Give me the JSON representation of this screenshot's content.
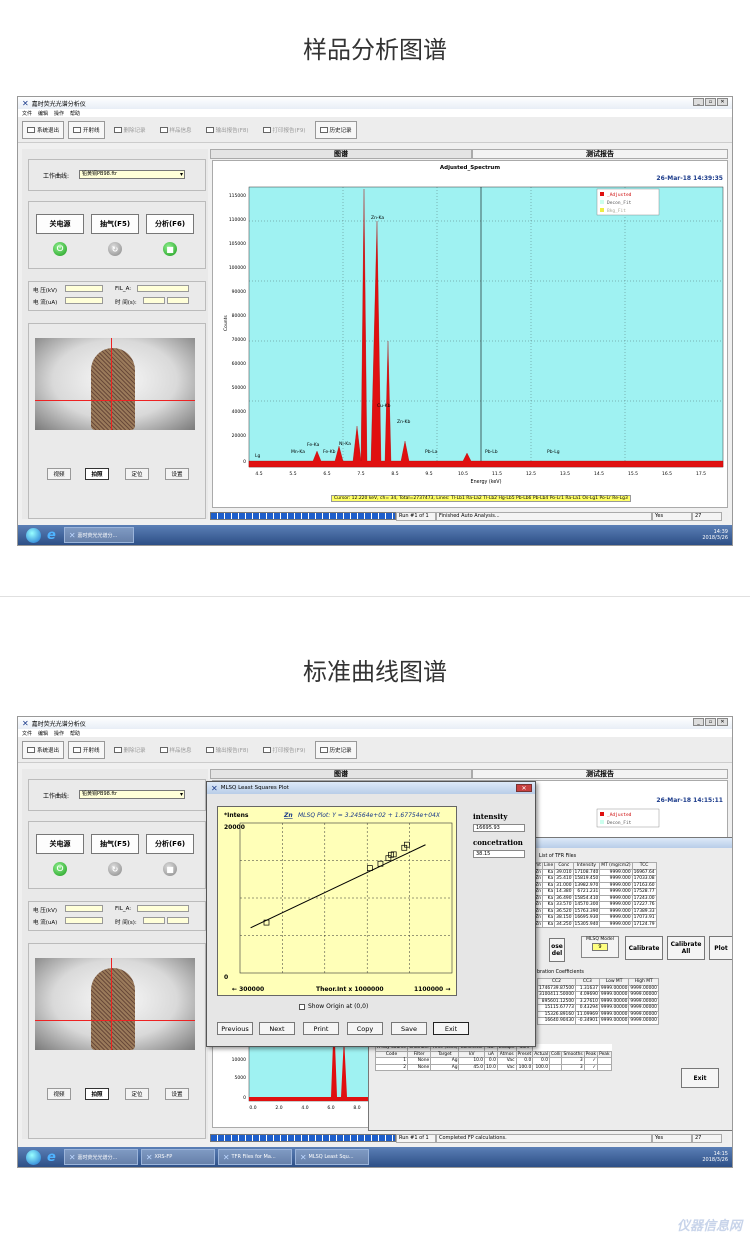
{
  "section1": {
    "heading": "样品分析图谱"
  },
  "section2": {
    "heading": "标准曲线图谱"
  },
  "app": {
    "title": "嘉时荧光光谱分析仪",
    "menu": [
      "文件",
      "编辑",
      "操作",
      "帮助"
    ],
    "toolbar": [
      "系统退出",
      "开射线",
      "删除记录",
      "样品信息",
      "输出报告(F8)",
      "打印报告(F9)",
      "历史记录"
    ],
    "curve_label": "工作曲线:",
    "curve_value": "铅黄铜PB98.ftr",
    "buttons": {
      "power": "关电源",
      "vacuum": "抽气(F5)",
      "analyze": "分析(F6)"
    },
    "fields": {
      "voltage": "电  压(kV)",
      "fil": "FIL_A:",
      "current": "电  流(uA)",
      "time": "时  间(s):"
    },
    "camera_buttons": [
      "视频",
      "拍照",
      "定位",
      "设置"
    ],
    "tabs": [
      "图谱",
      "测试报告"
    ]
  },
  "shot1": {
    "spectrum_title": "Adjusted_Spectrum",
    "date": "26-Mar-18  14:39:35",
    "legend": [
      "_Adjusted",
      "Decon_Fit",
      "Bkg_Fit"
    ],
    "ylabel": "Counts",
    "xlabel": "Energy (keV)",
    "cursor": "Cursor: 12.220 keV,  ch= 34,  Total=2737473,  Lines: Tl-Lb1 Ra-La2 Tl-Lb2 Hg-Lb5 Pb-Lb6 Pb-Lb4 Po-Lr1 Ra-La1 Os-Lg1 Po-Lr  Re-Lg3",
    "peak_labels": [
      "Fe-Ka",
      "Mn-Ka",
      "Fe-Kb",
      "Ni-Ka",
      "Zn-Ka",
      "Cu-Kb",
      "Zn-Kb",
      "Pb-La",
      "Pb-Lb",
      "Pb-Lg",
      "Lg",
      "Ni-Kb"
    ],
    "status": {
      "run": "Run #1 of 1",
      "message": "Finished Auto Analysis...",
      "yes": "Yes",
      "num": "27"
    },
    "taskbar": {
      "item": "嘉时荧光光谱分...",
      "time": "14:39",
      "date": "2018/3/26"
    }
  },
  "shot2": {
    "date": "26-Mar-18  14:15:11",
    "legend": [
      "_Adjusted",
      "Decon_Fit"
    ],
    "dialog": {
      "title": "MLSQ Least Squares Plot",
      "y_axis": "*Intens",
      "plot_title_el": "Zn",
      "plot_title": "MLSQ Plot:  Y = 3.24564e+02 + 1.67754e+04X",
      "ymax": "20000",
      "ymin": "0",
      "x_left": "300000",
      "x_mid": "Theor.Int x 1000000",
      "x_right": "1100000",
      "intensity_label": "intensity",
      "intensity_value": "16695.93",
      "concentration_label": "concetration",
      "concentration_value": "38.15",
      "show_origin": "Show Origin at (0,0)",
      "buttons": [
        "Previous",
        "Next",
        "Print",
        "Copy",
        "Save",
        "Exit"
      ]
    },
    "tfr": {
      "list_title": "List of TFR Files",
      "headers": [
        "Elmt",
        "Line",
        "Conc",
        "Intensity",
        "MT (mg/cm2)",
        "TCC"
      ],
      "rows": [
        [
          "Zn",
          "Ka",
          "39.010",
          "17108.740",
          "9999.000",
          "16967.64"
        ],
        [
          "Zn",
          "Ka",
          "35.410",
          "15819.450",
          "9999.000",
          "17033.08"
        ],
        [
          "Zn",
          "Ka",
          "31.000",
          "13982.970",
          "9999.000",
          "17163.60"
        ],
        [
          "Zn",
          "Ka",
          "14.380",
          "6721.231",
          "9999.000",
          "17528.77"
        ],
        [
          "Zn",
          "Ka",
          "36.490",
          "15854.410",
          "9999.000",
          "17243.00"
        ],
        [
          "Zn",
          "Ka",
          "33.570",
          "14570.300",
          "9999.000",
          "17227.76"
        ],
        [
          "Zn",
          "Ka",
          "36.520",
          "15763.390",
          "9999.000",
          "17389.33"
        ],
        [
          "Zn",
          "Ka",
          "38.150",
          "16695.930",
          "9999.000",
          "17073.91"
        ],
        [
          "Zn",
          "Ka",
          "34.250",
          "15305.940",
          "9999.000",
          "17124.79"
        ]
      ],
      "mlsq_model_label": "MLSQ Model",
      "mlsq_model_value": "9",
      "close_model": "ose\ndel",
      "buttons": [
        "Calibrate",
        "Calibrate All",
        "Plot",
        "Exit"
      ],
      "coef_title": "bration Coefficients",
      "coef_headers": [
        "CC2",
        "CC3",
        "Low MT",
        "High MT"
      ],
      "coef_rows": [
        [
          "1746739.87500",
          "1.31637",
          "9999.00000",
          "9999.00000"
        ],
        [
          "3100411.50000",
          "4.09690",
          "9999.00000",
          "9999.00000"
        ],
        [
          "895601.12500",
          "3.27610",
          "9999.00000",
          "9999.00000"
        ],
        [
          "15115.67773",
          "0.43294",
          "9999.00000",
          "9999.00000"
        ],
        [
          "15326.89160",
          "11.09969",
          "9999.00000",
          "9999.00000"
        ],
        [
          "16640.90430",
          "-0.34901",
          "9999.00000",
          "9999.00000"
        ]
      ],
      "meas_title": "Measurement & Processing Conditions:",
      "meas_groups": [
        "X-Ray Source",
        "Chamber",
        "Time (secs)",
        "Collimeter",
        "No.",
        "Escape",
        "Sum"
      ],
      "meas_headers": [
        "Code",
        "Filter",
        "Target",
        "kV",
        "uA",
        "Atmos",
        "Preset",
        "Actual",
        "Colli",
        "Smooths",
        "Peak",
        "Peak"
      ],
      "meas_rows": [
        [
          "1",
          "None",
          "Ag",
          "10.0",
          "0.0",
          "Vac",
          "0.0",
          "0.0",
          "",
          "3",
          "✓",
          ""
        ],
        [
          "2",
          "None",
          "Ag",
          "45.0",
          "10.0",
          "Vac",
          "100.0",
          "100.0",
          "",
          "3",
          "✓",
          ""
        ]
      ]
    },
    "bg_yticks": [
      "20000",
      "15000",
      "10000",
      "5000",
      "0"
    ],
    "bg_xticks": [
      "0.0",
      "2.0",
      "4.0",
      "6.0",
      "8.0"
    ],
    "status": {
      "run": "Run #1 of 1",
      "message": "Completed FP calculations.",
      "yes": "Yes",
      "num": "27"
    },
    "taskbar": {
      "items": [
        "嘉时荧光光谱分...",
        "XRS-FP",
        "TFR Files for Ma...",
        "MLSQ Least Squ..."
      ],
      "time": "14:15",
      "date": "2018/3/26"
    }
  },
  "watermark": "仪器信息网",
  "chart_data": {
    "type": "scatter",
    "title": "MLSQ Plot:  Y = 3.24564e+02 + 1.67754e+04X",
    "xlabel": "Theor.Int x 1000000",
    "ylabel": "*Intens",
    "xlim": [
      300000,
      1100000
    ],
    "ylim": [
      0,
      20000
    ],
    "x": [
      0.4,
      0.79,
      0.83,
      0.86,
      0.87,
      0.88,
      0.92,
      0.93
    ],
    "y": [
      6721,
      13983,
      14570,
      15306,
      15763,
      15819,
      16696,
      17109
    ],
    "fit_line": {
      "intercept": 324.564,
      "slope": 16775.4
    }
  }
}
